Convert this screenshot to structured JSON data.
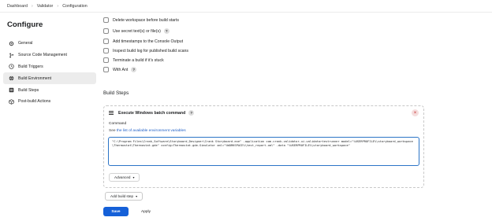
{
  "breadcrumb": [
    "Dashboard",
    "Validator",
    "Configuration"
  ],
  "page_title": "Configure",
  "sidebar": {
    "items": [
      {
        "label": "General",
        "icon": "gear-icon"
      },
      {
        "label": "Source Code Management",
        "icon": "branch-icon"
      },
      {
        "label": "Build Triggers",
        "icon": "clock-icon"
      },
      {
        "label": "Build Environment",
        "icon": "globe-icon",
        "active": true
      },
      {
        "label": "Build Steps",
        "icon": "list-icon"
      },
      {
        "label": "Post-build Actions",
        "icon": "cube-icon"
      }
    ]
  },
  "build_env_options": [
    {
      "label": "Delete workspace before build starts",
      "help": false
    },
    {
      "label": "Use secret text(s) or file(s)",
      "help": true
    },
    {
      "label": "Add timestamps to the Console Output",
      "help": false
    },
    {
      "label": "Inspect build log for published build scans",
      "help": false
    },
    {
      "label": "Terminate a build if it's stuck",
      "help": false
    },
    {
      "label": "With Ant",
      "help": true
    }
  ],
  "build_steps": {
    "title": "Build Steps",
    "step_title": "Execute Windows batch command",
    "command_label": "Command",
    "env_prefix": "See ",
    "env_link": "the list of available environment variables",
    "command": "\"C:\\Program Files\\Crank_Software\\Storyboard_Designer\\Crank Storyboard.exe\" -application com.crank.validator.ui.validatortestrunner model=\"%USERPROFILE%\\storyboard_workspace\\Thermostat\\Thermostat.gde\" config=Thermostat.gde-Simulator xml=\"%WORKSPACE%\\test_report.xml\" -data \"%USERPROFILE%\\storyboard_workspace\"",
    "advanced_label": "Advanced",
    "add_step_label": "Add build step"
  },
  "buttons": {
    "save": "Save",
    "apply": "Apply"
  },
  "help_glyph": "?",
  "close_glyph": "×",
  "colors": {
    "primary": "#1560d8",
    "link": "#1f5fc6",
    "active_nav": "#ececec",
    "close": "#c62828"
  }
}
